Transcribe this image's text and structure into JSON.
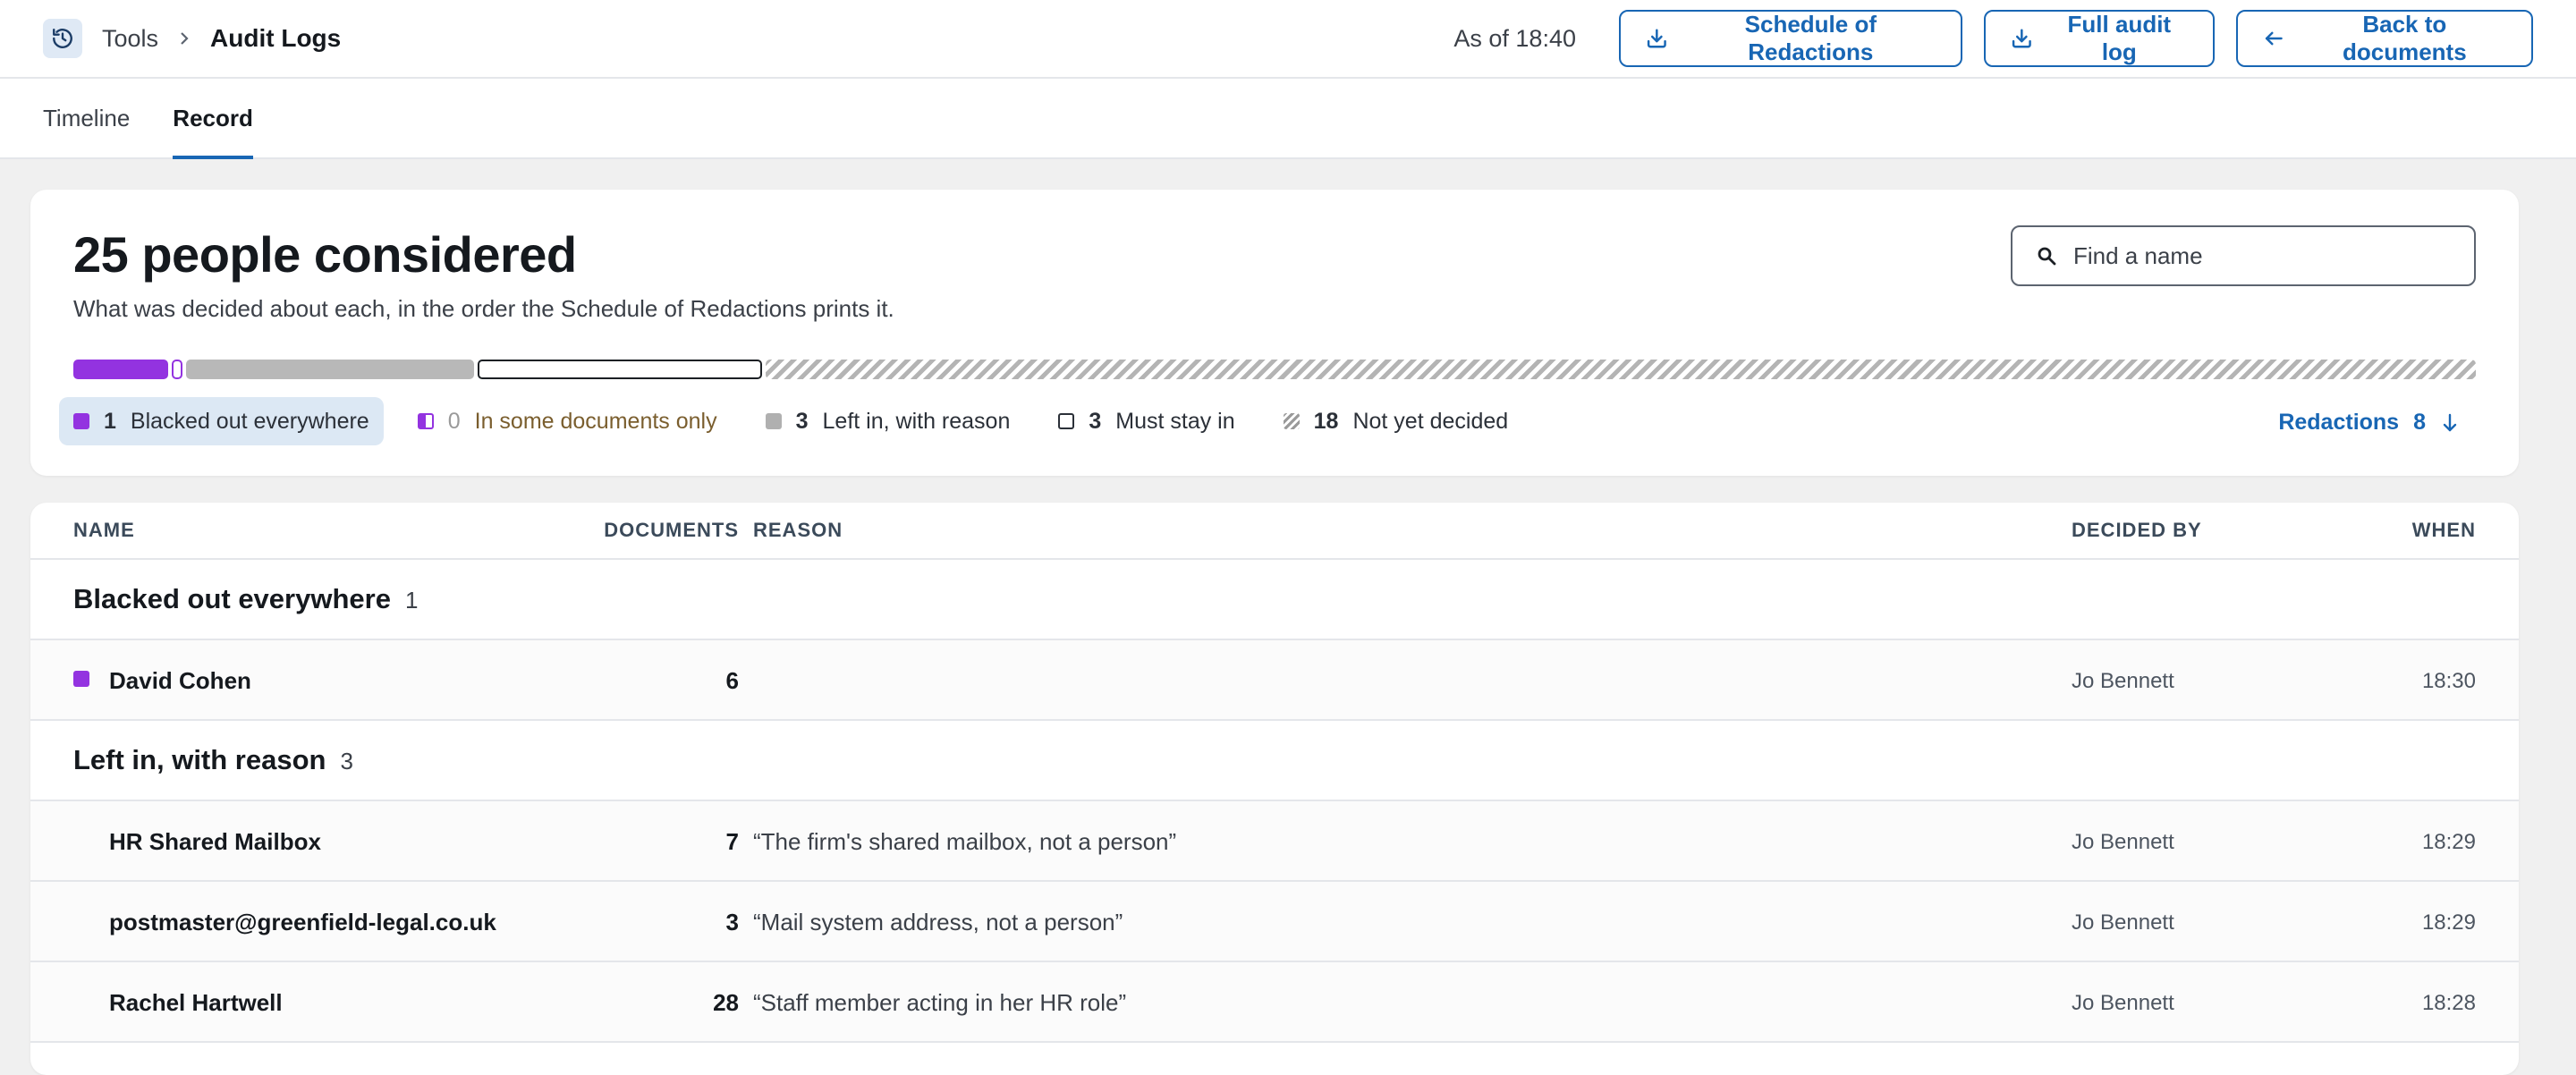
{
  "header": {
    "icon": "history-icon",
    "breadcrumb_parent": "Tools",
    "breadcrumb_current": "Audit Logs",
    "as_of": "As of 18:40",
    "buttons": {
      "schedule": "Schedule of Redactions",
      "full_log": "Full audit log",
      "back": "Back to documents"
    }
  },
  "tabs": [
    {
      "label": "Timeline",
      "active": false
    },
    {
      "label": "Record",
      "active": true
    }
  ],
  "summary": {
    "title": "25 people considered",
    "subtitle": "What was decided about each, in the order the Schedule of Redactions prints it.",
    "search_placeholder": "Find a name",
    "legend": [
      {
        "count": "1",
        "label": "Blacked out everywhere",
        "swatch": "#9333e0",
        "active": true
      },
      {
        "count": "0",
        "label": "In some documents only",
        "swatch": "#9333e0",
        "active": false
      },
      {
        "count": "3",
        "label": "Left in, with reason",
        "swatch": "#b0b0b0",
        "active": false
      },
      {
        "count": "3",
        "label": "Must stay in",
        "swatch": "#ffffff",
        "active": false
      },
      {
        "count": "18",
        "label": "Not yet decided",
        "swatch": "hatched",
        "active": false
      }
    ],
    "progress_counts": {
      "blacked_out": 1,
      "some_documents": 0,
      "left_in": 3,
      "must_stay": 3,
      "undecided": 18
    },
    "redactions_label": "Redactions",
    "redactions_count": "8"
  },
  "table": {
    "columns": {
      "name": "NAME",
      "documents": "DOCUMENTS",
      "reason": "REASON",
      "decided_by": "DECIDED BY",
      "when": "WHEN"
    },
    "groups": [
      {
        "title": "Blacked out everywhere",
        "count": "1",
        "rows": [
          {
            "name": "David Cohen",
            "documents": "6",
            "reason": "",
            "decided_by": "Jo Bennett",
            "when": "18:30"
          }
        ]
      },
      {
        "title": "Left in, with reason",
        "count": "3",
        "rows": [
          {
            "name": "HR Shared Mailbox",
            "documents": "7",
            "reason": "“The firm's shared mailbox, not a person”",
            "decided_by": "Jo Bennett",
            "when": "18:29"
          },
          {
            "name": "postmaster@greenfield-legal.co.uk",
            "documents": "3",
            "reason": "“Mail system address, not a person”",
            "decided_by": "Jo Bennett",
            "when": "18:29"
          },
          {
            "name": "Rachel Hartwell",
            "documents": "28",
            "reason": "“Staff member acting in her HR role”",
            "decided_by": "Jo Bennett",
            "when": "18:28"
          }
        ]
      }
    ]
  },
  "colors": {
    "accent": "#1866b4",
    "blacked_out": "#9333e0",
    "left_in": "#b8b8b8"
  }
}
